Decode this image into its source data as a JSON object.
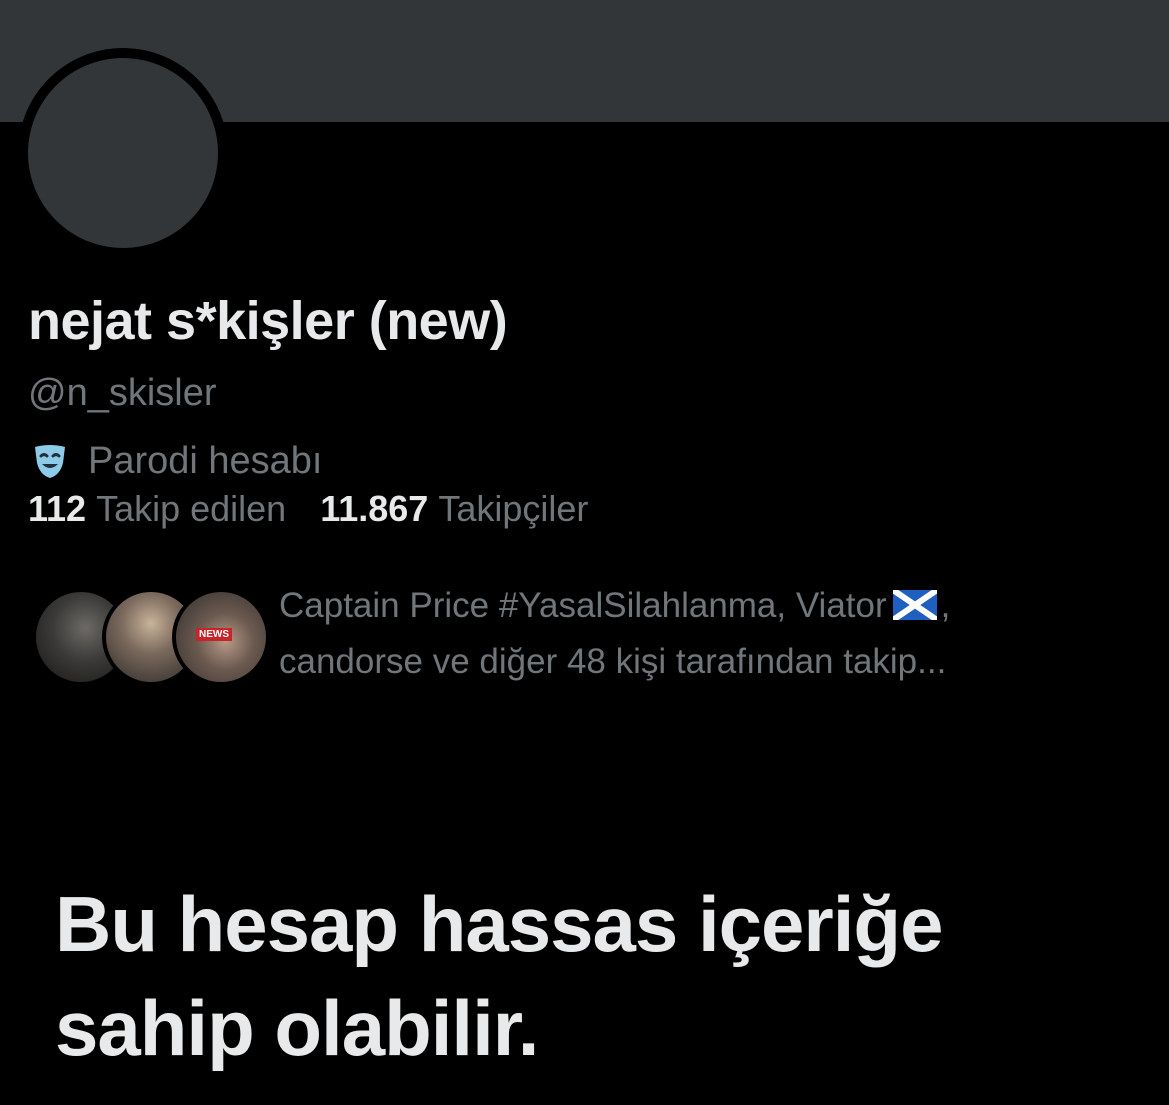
{
  "profile": {
    "display_name": "nejat s*kişler (new)",
    "handle": "@n_skisler",
    "parody_label": "Parodi hesabı",
    "parody_icon": "theater-mask-icon"
  },
  "stats": {
    "following_count": "112",
    "following_label": "Takip edilen",
    "followers_count": "11.867",
    "followers_label": "Takipçiler"
  },
  "followed_by": {
    "line1_text": "Captain Price #YasalSilahlanma, Viator",
    "line1_flag": "scotland-flag-icon",
    "line1_after": ",",
    "line2_text": "candorse ve diğer 48 kişi tarafından takip...",
    "avatar3_badge": "NEWS"
  },
  "sensitive_notice": {
    "line1": "Bu hesap hassas içeriğe",
    "line2": "sahip olabilir."
  },
  "colors": {
    "background": "#000000",
    "banner": "#333639",
    "primary_text": "#e7e9ea",
    "secondary_text": "#71767b",
    "parody_icon": "#8ecbe8"
  }
}
